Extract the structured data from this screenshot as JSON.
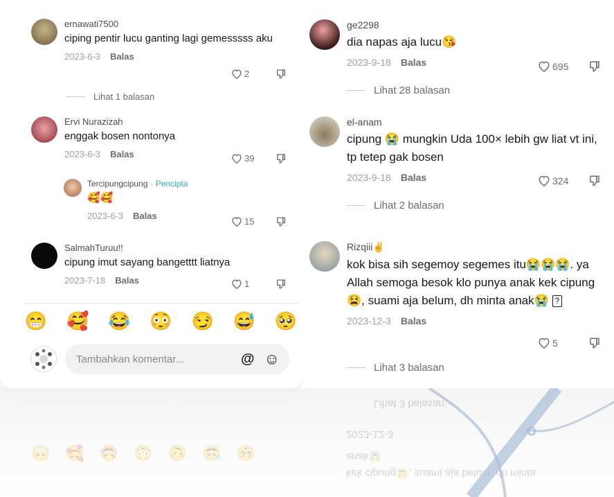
{
  "left_comments": [
    {
      "username": "ernawati7500",
      "text": "ciping pentir lucu ganting lagi gemesssss aku",
      "date": "2023-6-3",
      "reply_label": "Balas",
      "likes": "2",
      "view_replies": "Lihat 1 balasan"
    },
    {
      "username": "Ervi Nurazizah",
      "text": "enggak bosen nontonya",
      "date": "2023-6-3",
      "reply_label": "Balas",
      "likes": "39"
    },
    {
      "username": "Tercipungcipung",
      "creator_label": "· Pencipta",
      "text": "🥰🥰",
      "date": "2023-6-3",
      "reply_label": "Balas",
      "likes": "15"
    },
    {
      "username": "SalmahTuruu!!",
      "text": "cipung imut sayang bangetttt liatnya",
      "date": "2023-7-18",
      "reply_label": "Balas",
      "likes": "1"
    }
  ],
  "right_comments": [
    {
      "username": "ge2298",
      "text": "dia napas aja lucu😘",
      "date": "2023-9-18",
      "reply_label": "Balas",
      "likes": "695",
      "view_replies": "Lihat 28 balasan"
    },
    {
      "username": "el-anam",
      "text": "cipung 😭 mungkin Uda 100× lebih gw liat vt ini, tp tetep gak bosen",
      "date": "2023-9-18",
      "reply_label": "Balas",
      "likes": "324",
      "view_replies": "Lihat 2 balasan"
    },
    {
      "username": "Rizqiii✌",
      "text": "kok bisa sih segemoy segemes itu😭😭😭. ya Allah semoga besok klo punya anak kek cipung😫, suami aja belum, dh minta anak😭",
      "inline_box": "?",
      "date": "2023-12-3",
      "reply_label": "Balas",
      "likes": "5",
      "view_replies": "Lihat 3 balasan"
    }
  ],
  "emoji_bar": [
    "😁",
    "🥰",
    "😂",
    "😳",
    "😏",
    "😅",
    "🥺"
  ],
  "composer": {
    "placeholder": "Tambahkan komentar...",
    "mention_icon": "@",
    "emoji_icon": "☺"
  },
  "reflection_text": [
    "Lihat 3 balasan",
    "2023-12-3",
    "anak😭",
    "kek cipung😫, suami aja belum, dh minta"
  ],
  "colors": {
    "accent": "#2ba7c6",
    "text": "#161823",
    "muted": "#a0a1a8",
    "watermark": "#a9bfd6"
  }
}
